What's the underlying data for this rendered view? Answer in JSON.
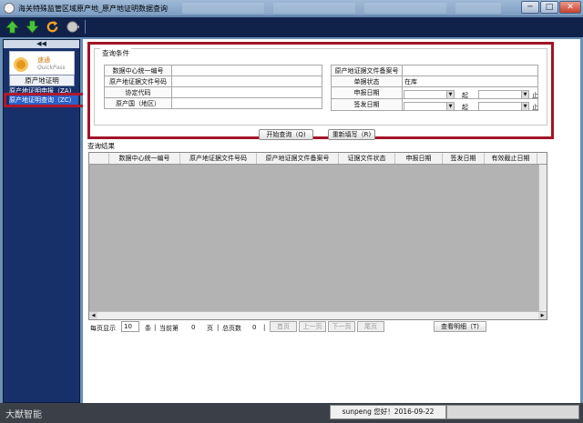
{
  "window": {
    "title": "海关特殊监管区域原产地_原产地证明数据查询",
    "min": "─",
    "max": "□",
    "close": "✕"
  },
  "toolbar": {
    "icons": [
      "up-arrow-icon",
      "down-arrow-icon",
      "refresh-icon",
      "globe-icon"
    ]
  },
  "sidebar": {
    "collapse": "◀◀",
    "logo_cn": "速通",
    "logo_en": "QuickPass",
    "category": "原产地证明",
    "items": [
      {
        "label": "原产地证明申报（ZA)"
      },
      {
        "label": "原产地证明查询（ZC）"
      }
    ]
  },
  "query": {
    "group_title": "查询条件",
    "left_rows": [
      {
        "label": "数据中心统一编号",
        "value": ""
      },
      {
        "label": "原产地证据文件号码",
        "value": ""
      },
      {
        "label": "协定代码",
        "value": ""
      },
      {
        "label": "原产国（地区）",
        "value": ""
      }
    ],
    "right_rows": [
      {
        "label": "原产地证据文件备案号",
        "value": ""
      },
      {
        "label": "单据状态",
        "value": "在库"
      },
      {
        "label": "申报日期",
        "value": ""
      },
      {
        "label": "签发日期",
        "value": ""
      }
    ],
    "from_label": "起",
    "to_label": "止",
    "search_button": "开始查询（Q)",
    "reset_button": "重新填写（R)"
  },
  "results": {
    "title": "查询结果",
    "columns": [
      "数据中心统一编号",
      "原产地证据文件号码",
      "原产地证据文件备案号",
      "证据文件状态",
      "申报日期",
      "签发日期",
      "有效截止日期"
    ],
    "rows": []
  },
  "pager": {
    "per_page_label": "每页显示",
    "per_page": "10",
    "rows_label": "条",
    "current_label": "当前第",
    "current": "0",
    "page_label": "页",
    "total_label": "总页数",
    "total": "0",
    "first": "首页",
    "prev": "上一页",
    "next": "下一页",
    "last": "尾页",
    "detail_button": "查看明细（T)"
  },
  "status": {
    "brand": "大猷智能",
    "user_text": "sunpeng  您好！2016-09-22"
  },
  "colors": {
    "highlight_border": "#a11427",
    "sidebar_bg": "#18306a",
    "selected_nav": "#2a61c8",
    "grid_bg": "#b3b3b3"
  }
}
